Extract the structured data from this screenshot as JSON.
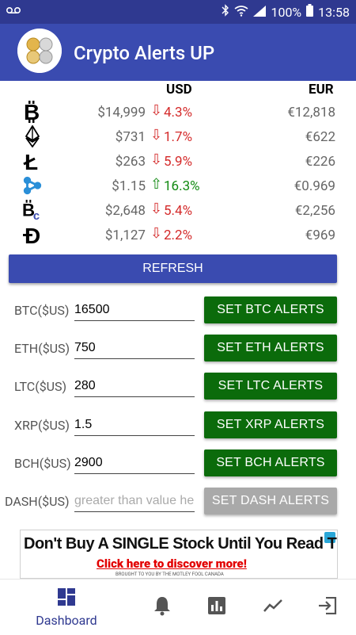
{
  "status_bar": {
    "voicemail_icon": "voicemail-icon",
    "battery": "100%",
    "time": "13:58"
  },
  "app": {
    "title": "Crypto Alerts UP",
    "primary_color": "#3a4bb0",
    "status_color": "#2f3990"
  },
  "prices": {
    "headers": {
      "usd": "USD",
      "eur": "EUR"
    },
    "rows": [
      {
        "coin": "BTC",
        "icon": "bitcoin-icon",
        "usd": "$14,999",
        "dir": "down",
        "change": "4.3%",
        "eur": "€12,818"
      },
      {
        "coin": "ETH",
        "icon": "ethereum-icon",
        "usd": "$731",
        "dir": "down",
        "change": "1.7%",
        "eur": "€622"
      },
      {
        "coin": "LTC",
        "icon": "litecoin-icon",
        "usd": "$263",
        "dir": "down",
        "change": "5.9%",
        "eur": "€226"
      },
      {
        "coin": "XRP",
        "icon": "ripple-icon",
        "usd": "$1.15",
        "dir": "up",
        "change": "16.3%",
        "eur": "€0.969"
      },
      {
        "coin": "BCH",
        "icon": "bitcoin-cash-icon",
        "usd": "$2,648",
        "dir": "down",
        "change": "5.4%",
        "eur": "€2,256"
      },
      {
        "coin": "DASH",
        "icon": "dash-icon",
        "usd": "$1,127",
        "dir": "down",
        "change": "2.2%",
        "eur": "€969"
      }
    ]
  },
  "refresh_label": "REFRESH",
  "alerts": [
    {
      "label": "BTC($US)",
      "value": "16500",
      "placeholder": "",
      "button": "SET BTC ALERTS",
      "enabled": true
    },
    {
      "label": "ETH($US)",
      "value": "750",
      "placeholder": "",
      "button": "SET ETH ALERTS",
      "enabled": true
    },
    {
      "label": "LTC($US)",
      "value": "280",
      "placeholder": "",
      "button": "SET LTC ALERTS",
      "enabled": true
    },
    {
      "label": "XRP($US)",
      "value": "1.5",
      "placeholder": "",
      "button": "SET XRP ALERTS",
      "enabled": true
    },
    {
      "label": "BCH($US)",
      "value": "2900",
      "placeholder": "",
      "button": "SET BCH ALERTS",
      "enabled": true
    },
    {
      "label": "DASH($US)",
      "value": "",
      "placeholder": "greater than value here",
      "button": "SET DASH ALERTS",
      "enabled": false
    }
  ],
  "ad": {
    "headline": "Don't Buy A SINGLE Stock Until You Read This",
    "cta": "Click here to discover more!",
    "small": "BROUGHT TO YOU BY THE MOTLEY FOOL CANADA"
  },
  "nav": {
    "dashboard_label": "Dashboard",
    "items": [
      "dashboard-icon",
      "bell-icon",
      "bar-chart-icon",
      "trend-line-icon",
      "exit-icon"
    ]
  }
}
